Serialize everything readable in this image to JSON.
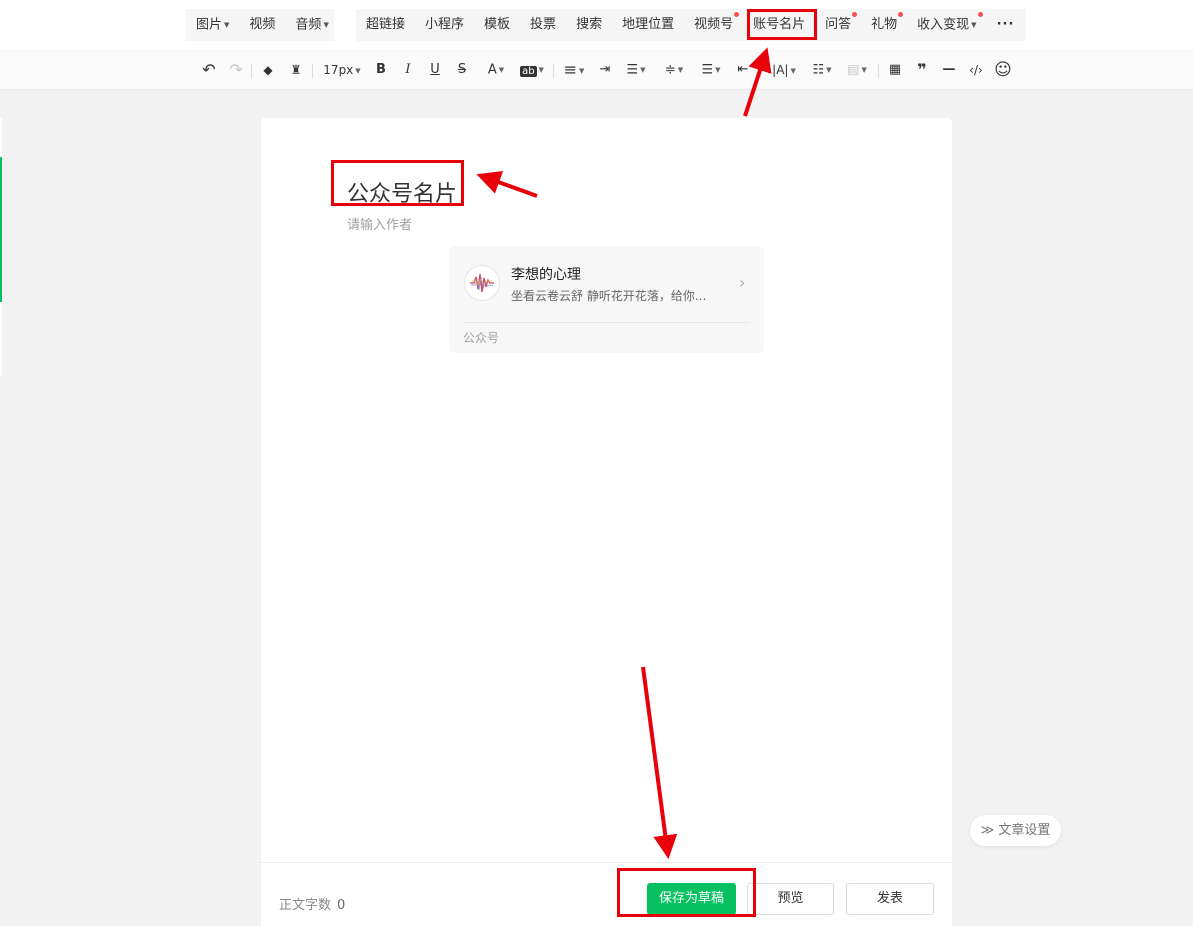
{
  "menu": {
    "group1": [
      {
        "label": "图片",
        "dropdown": true
      },
      {
        "label": "视频",
        "dropdown": false
      },
      {
        "label": "音频",
        "dropdown": true
      }
    ],
    "group2": [
      {
        "label": "超链接",
        "dot": false,
        "dropdown": false
      },
      {
        "label": "小程序",
        "dot": false,
        "dropdown": false
      },
      {
        "label": "模板",
        "dot": false,
        "dropdown": false
      },
      {
        "label": "投票",
        "dot": false,
        "dropdown": false
      },
      {
        "label": "搜索",
        "dot": false,
        "dropdown": false
      },
      {
        "label": "地理位置",
        "dot": false,
        "dropdown": false
      },
      {
        "label": "视频号",
        "dot": true,
        "dropdown": false
      },
      {
        "label": "账号名片",
        "dot": false,
        "dropdown": false
      },
      {
        "label": "问答",
        "dot": true,
        "dropdown": false
      },
      {
        "label": "礼物",
        "dot": true,
        "dropdown": false
      },
      {
        "label": "收入变现",
        "dot": true,
        "dropdown": true
      }
    ],
    "more_label": "···"
  },
  "toolbar": {
    "undo": "↶",
    "redo": "↷",
    "eraser": "◆",
    "brush": "♜",
    "font_size": "17px",
    "bold": "B",
    "italic": "I",
    "underline": "U",
    "strike": "S",
    "font_color": "A",
    "highlight": "ab",
    "align_left": "≡",
    "indent_right": "⇥",
    "indent_center": "☰",
    "line_height": "≑",
    "spacing": "☰",
    "outdent": "⇤",
    "letter_spacing": "|A|",
    "list": "☷",
    "style": "▤",
    "table": "▦",
    "quote": "❞",
    "divider": "—",
    "code": "‹/›",
    "emoji": "☺"
  },
  "editor": {
    "title": "公众号名片",
    "author_placeholder": "请输入作者",
    "card": {
      "name": "李想的心理",
      "description": "坐看云卷云舒 静听花开花落，给你...",
      "type": "公众号",
      "arrow": "›"
    }
  },
  "footer": {
    "word_count_label": "正文字数",
    "word_count": "0",
    "save_draft": "保存为草稿",
    "preview": "预览",
    "publish": "发表"
  },
  "settings_pill": "≫ 文章设置",
  "colors": {
    "accent": "#07c160",
    "annotation": "#e8000b",
    "dot": "#fa5151"
  }
}
